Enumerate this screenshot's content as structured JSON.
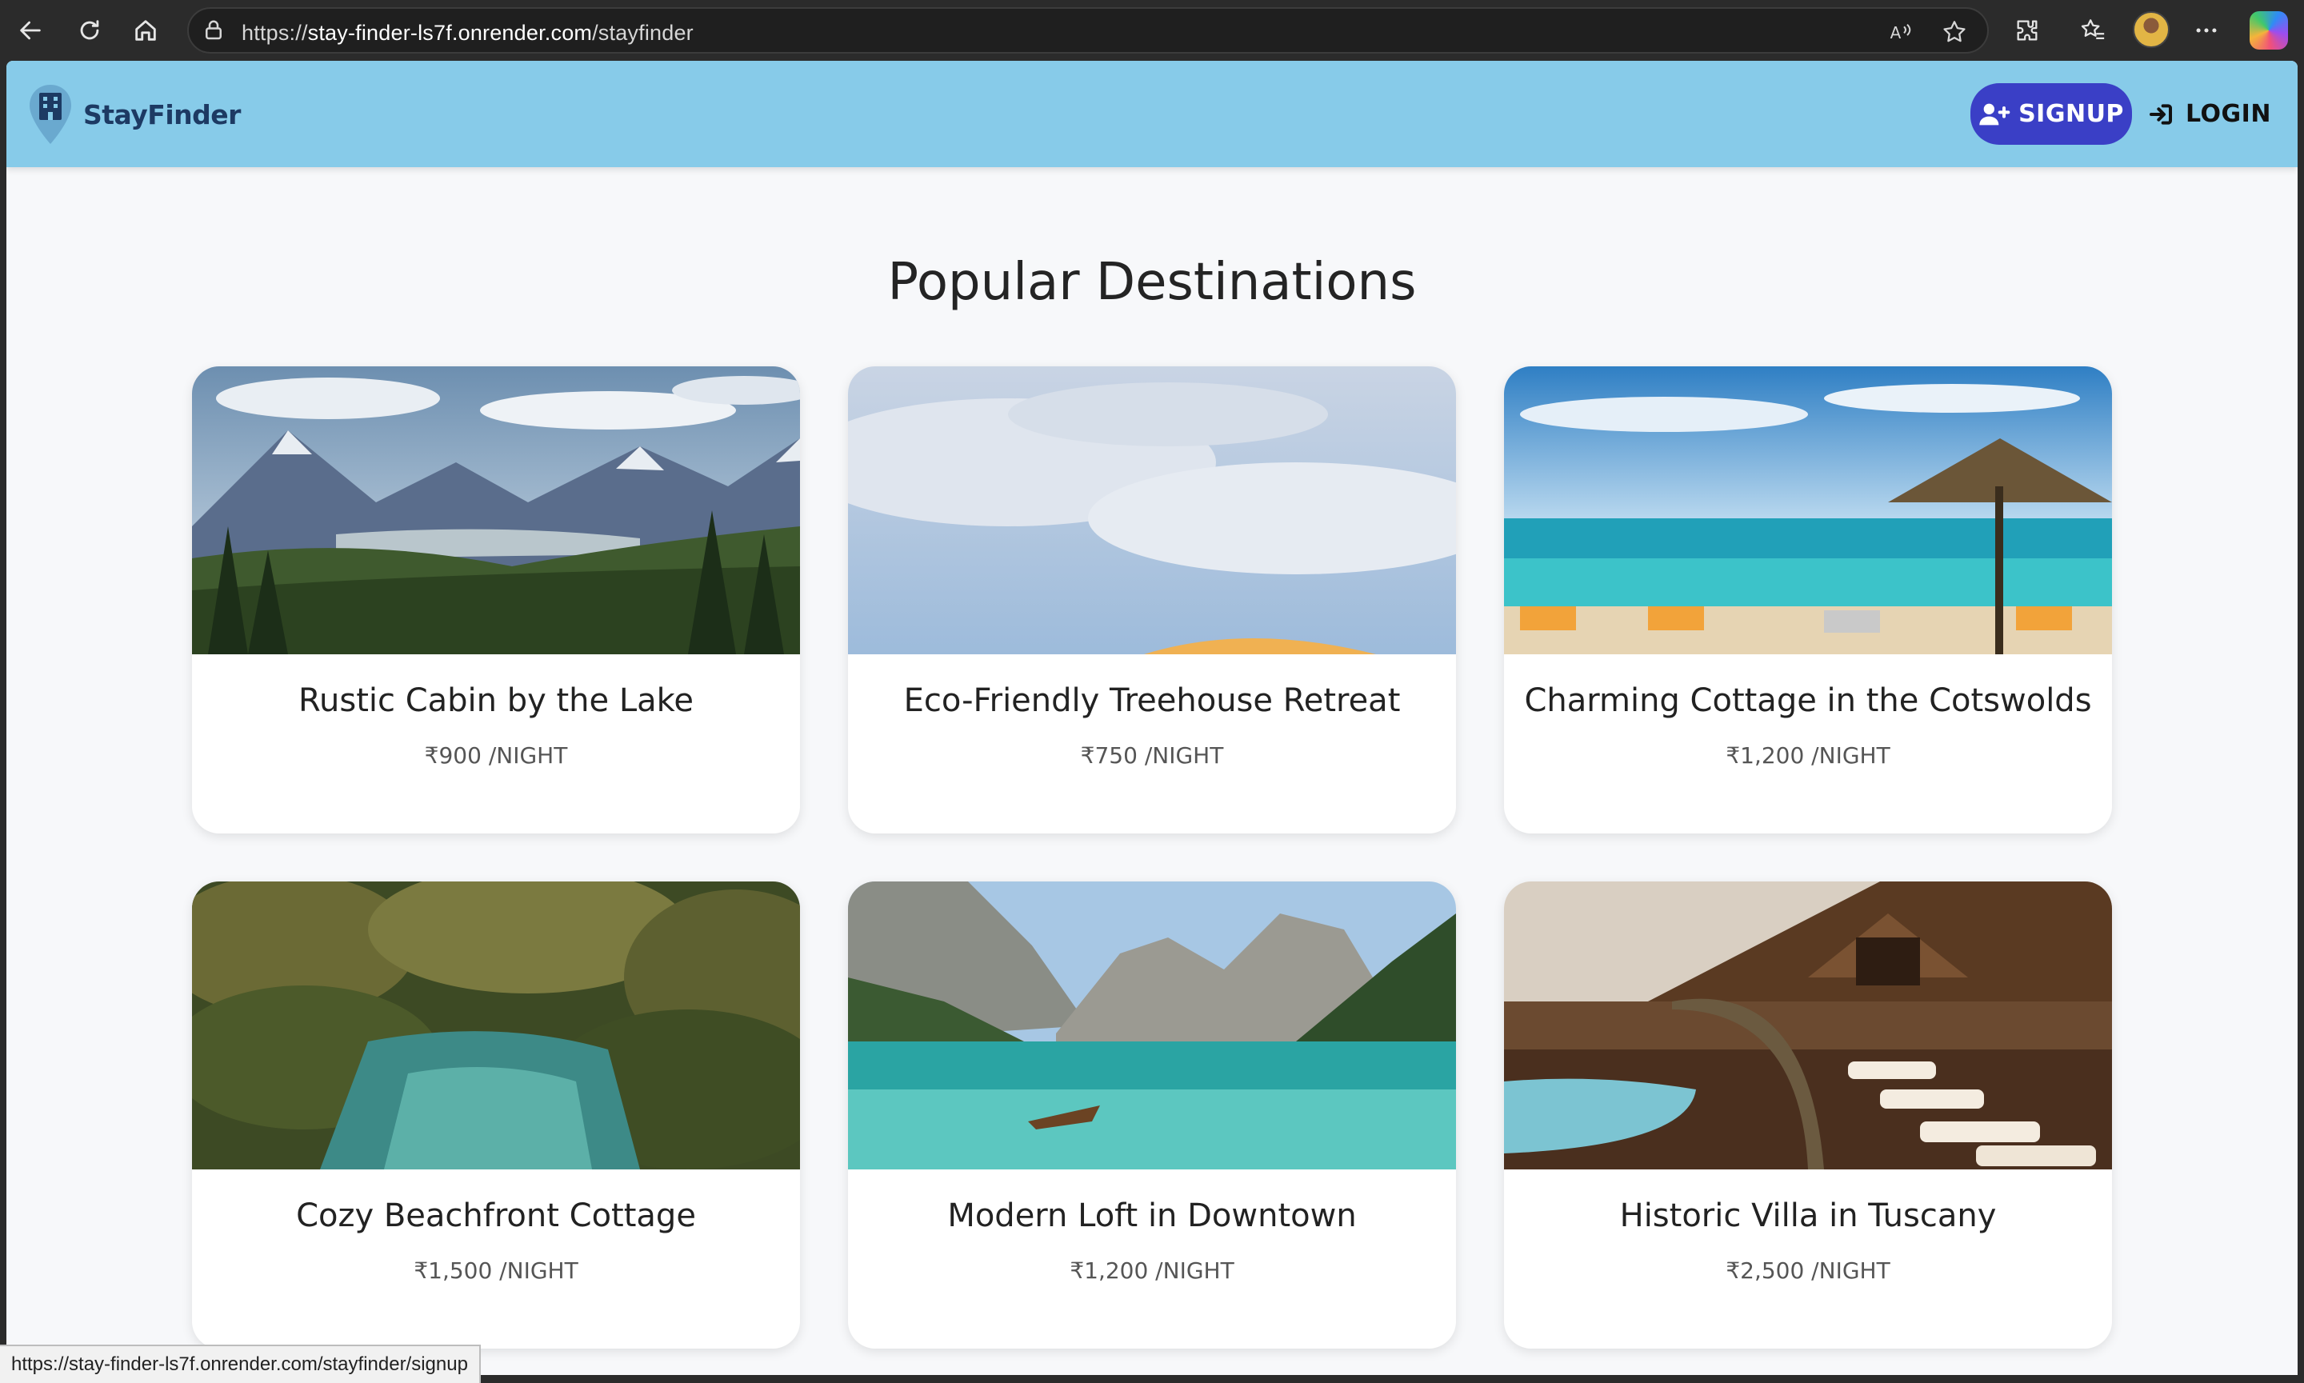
{
  "browser": {
    "url_prefix": "https://",
    "url_host": "stay-finder-ls7f.onrender.com",
    "url_path": "/stayfinder",
    "status_url": "https://stay-finder-ls7f.onrender.com/stayfinder/signup"
  },
  "header": {
    "brand": "StayFinder",
    "signup_label": "SIGNUP",
    "login_label": "LOGIN",
    "header_color": "#87cbe9",
    "signup_color": "#3a3fc6"
  },
  "main": {
    "title": "Popular Destinations",
    "cards": [
      {
        "title": "Rustic Cabin by the Lake",
        "price": "₹900 /NIGHT",
        "image": "mountain-valley-forest"
      },
      {
        "title": "Eco-Friendly Treehouse Retreat",
        "price": "₹750 /NIGHT",
        "image": "cloudy-sky-umbrella"
      },
      {
        "title": "Charming Cottage in the Cotswolds",
        "price": "₹1,200 /NIGHT",
        "image": "beach-umbrella-loungers"
      },
      {
        "title": "Cozy Beachfront Cottage",
        "price": "₹1,500 /NIGHT",
        "image": "palm-jungle-river"
      },
      {
        "title": "Modern Loft in Downtown",
        "price": "₹1,200 /NIGHT",
        "image": "mountain-lake-boat"
      },
      {
        "title": "Historic Villa in Tuscany",
        "price": "₹2,500 /NIGHT",
        "image": "resort-pool-lodge"
      }
    ]
  }
}
